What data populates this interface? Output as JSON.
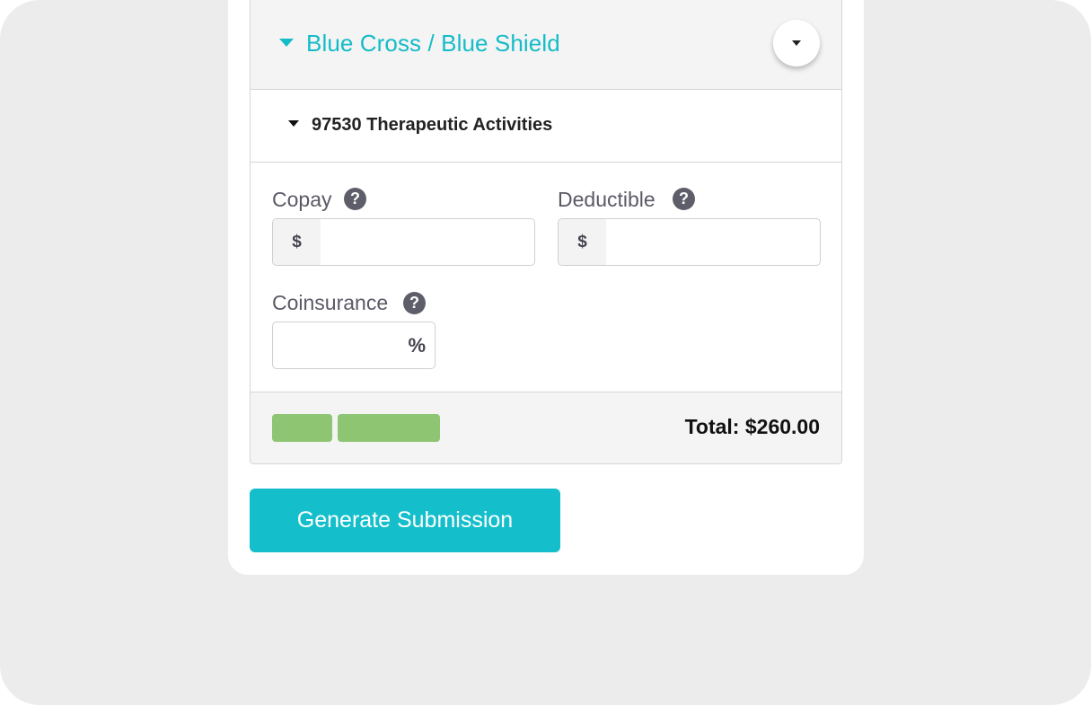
{
  "insurance": {
    "title": "Blue Cross / Blue Shield"
  },
  "procedure": {
    "code_label": "97530 Therapeutic Activities"
  },
  "fields": {
    "copay": {
      "label": "Copay",
      "prefix": "$",
      "value": ""
    },
    "deductible": {
      "label": "Deductible",
      "prefix": "$",
      "value": ""
    },
    "coinsurance": {
      "label": "Coinsurance",
      "suffix": "%",
      "value": ""
    },
    "help_glyph": "?"
  },
  "footer": {
    "total_label": "Total: $260.00"
  },
  "actions": {
    "generate_label": "Generate Submission"
  },
  "colors": {
    "accent": "#14bcc8",
    "green": "#8dc573",
    "background": "#ececec"
  }
}
